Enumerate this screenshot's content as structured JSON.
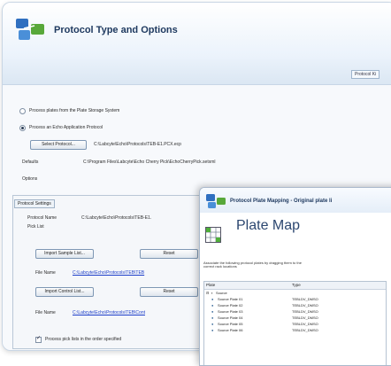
{
  "window": {
    "title": "Protocol Type and Options",
    "ribbon_tab": "Protocol Ki"
  },
  "options": {
    "radio_storage_label": "Process plates from the Plate Storage System",
    "radio_echo_label": "Process an Echo Application Protocol",
    "select_protocol_button": "Select Protocol...",
    "protocol_path": "C:\\Labcyte\\Echo\\Protocols\\TEB-E1.PCX.ecp",
    "defaults_label": "Defaults",
    "defaults_path": "C:\\Program Files\\Labcyte\\Echo Cherry Pick\\EchoCherryPick.setxml",
    "options_label": "Options"
  },
  "protocol_settings": {
    "tab_label": "Protocol Settings",
    "protocol_name_label": "Protocol Name",
    "protocol_name_value": "C:\\Labcyte\\Echo\\Protocols\\TEB-E1.",
    "pick_list_label": "Pick List",
    "import_sample_button": "Import Sample List...",
    "reset_button_1": "Reset",
    "file_name_label_1": "File Name",
    "file_name_link_1": "C:\\Labcyte\\Echo\\Protocols\\TEB\\TEB",
    "import_control_button": "Import Control List...",
    "reset_button_2": "Reset",
    "file_name_label_2": "File Name",
    "file_name_link_2": "C:\\Labcyte\\Echo\\Protocols\\TEB\\Cont",
    "process_checkbox_label": "Process pick lists in the order specified"
  },
  "plate_mapping": {
    "title": "Protocol Plate Mapping - Original plate li",
    "heading": "Plate Map",
    "description": "Associate the following protocol plates by dragging them to the correct rack locations",
    "col_plate": "Plate",
    "col_type": "Type",
    "tree_root": "Source",
    "rows": [
      {
        "name": "Source Plate 01",
        "type": "TEBLDV_DMSO"
      },
      {
        "name": "Source Plate 02",
        "type": "TEBLDV_DMSO"
      },
      {
        "name": "Source Plate 03",
        "type": "TEBLDV_DMSO"
      },
      {
        "name": "Source Plate 04",
        "type": "TEBLDV_DMSO"
      },
      {
        "name": "Source Plate 05",
        "type": "TEBLDV_DMSO"
      },
      {
        "name": "Source Plate 06",
        "type": "TEBLDV_DMSO"
      }
    ]
  }
}
